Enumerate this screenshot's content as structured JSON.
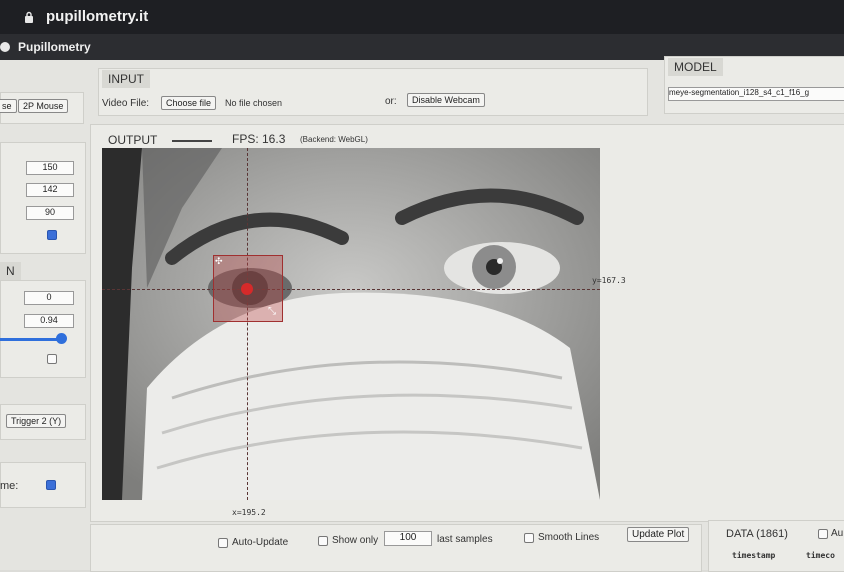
{
  "browser": {
    "url": "pupillometry.it",
    "app_title": "Pupillometry"
  },
  "input": {
    "header": "INPUT",
    "video_file_label": "Video File:",
    "choose_file_button": "Choose file",
    "no_file_text": "No file chosen",
    "or_label": "or:",
    "webcam_button": "Disable Webcam"
  },
  "model": {
    "header": "MODEL",
    "selected": "meye-segmentation_i128_s4_c1_f16_g"
  },
  "output": {
    "header": "OUTPUT",
    "fps": "FPS: 16.3",
    "backend": "(Backend: WebGL)"
  },
  "overlay": {
    "x_readout": "x=195.2",
    "y_readout": "y=167.3"
  },
  "left_panel": {
    "mouse_buttons": [
      "se",
      "2P Mouse"
    ],
    "values_a": [
      "150",
      "142",
      "90"
    ],
    "checkbox_a_checked": true,
    "section_tab": "N",
    "values_b": [
      "0",
      "0.94"
    ],
    "slider_level": 0.94,
    "checkbox_b_checked": false,
    "trigger_button": "Trigger 2 (Y)",
    "bottom_label": "me:",
    "checkbox_c_checked": true
  },
  "plot_controls": {
    "auto_update_label": "Auto-Update",
    "show_only_label": "Show only",
    "samples_value": "100",
    "last_samples_label": "last samples",
    "smooth_lines_label": "Smooth Lines",
    "update_plot_button": "Update Plot"
  },
  "data_panel": {
    "header": "DATA (1861)",
    "checkbox_label": "Au",
    "columns": [
      "timestamp",
      "timeco"
    ]
  }
}
